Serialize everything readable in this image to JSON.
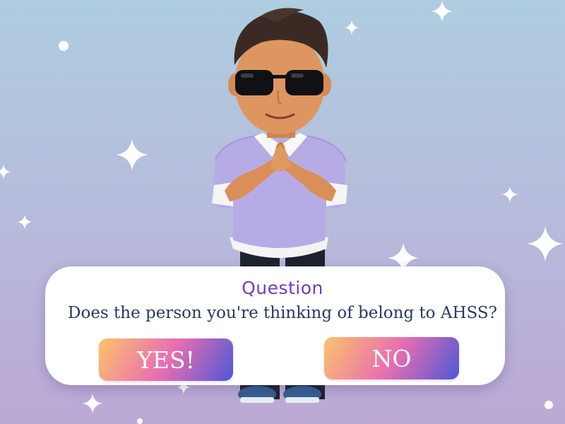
{
  "dialog": {
    "title": "Question",
    "question": "Does the person you're thinking of belong to AHSS?",
    "yes_label": "YES!",
    "no_label": "NO"
  },
  "colors": {
    "background_top": "#aecde0",
    "background_bottom": "#bca9d6",
    "title": "#6b3fc0",
    "question": "#263a63",
    "button_gradient": [
      "#fbc36a",
      "#ea6fb0",
      "#4d58d6"
    ]
  },
  "icons": [
    "sparkle-icon",
    "avatar-character"
  ]
}
